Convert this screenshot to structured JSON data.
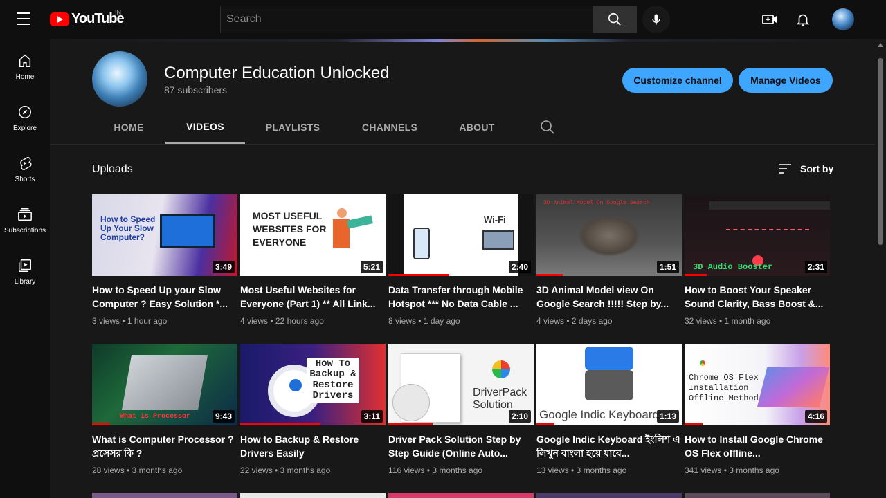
{
  "topbar": {
    "logo_text": "YouTube",
    "country_code": "IN",
    "search_placeholder": "Search"
  },
  "sidenav": [
    {
      "label": "Home",
      "icon": "home-icon"
    },
    {
      "label": "Explore",
      "icon": "compass-icon"
    },
    {
      "label": "Shorts",
      "icon": "shorts-icon"
    },
    {
      "label": "Subscriptions",
      "icon": "subscriptions-icon"
    },
    {
      "label": "Library",
      "icon": "library-icon"
    }
  ],
  "channel": {
    "name": "Computer Education Unlocked",
    "subscribers": "87 subscribers",
    "customize_label": "Customize channel",
    "manage_label": "Manage Videos"
  },
  "tabs": [
    "HOME",
    "VIDEOS",
    "PLAYLISTS",
    "CHANNELS",
    "ABOUT"
  ],
  "active_tab": "VIDEOS",
  "section": {
    "title": "Uploads",
    "sort_label": "Sort by"
  },
  "colors": {
    "accent": "#3ea6ff",
    "progress": "#ff0000",
    "background": "#181818"
  },
  "videos": [
    {
      "title": "How to Speed Up your Slow Computer ? Easy Solution *...",
      "meta": "3 views • 1 hour ago",
      "duration": "3:49",
      "thumb_text": "How to Speed Up Your Slow Computer?",
      "progress": 0
    },
    {
      "title": "Most Useful Websites for Everyone (Part 1) ** All Link...",
      "meta": "4 views • 22 hours ago",
      "duration": "5:21",
      "thumb_text": "MOST USEFUL WEBSITES FOR EVERYONE",
      "progress": 0
    },
    {
      "title": "Data Transfer through Mobile Hotspot *** No Data Cable ...",
      "meta": "8 views • 1 day ago",
      "duration": "2:40",
      "thumb_text": "Wi-Fi",
      "progress": 0.42
    },
    {
      "title": "3D Animal Model view On Google Search !!!!! Step by...",
      "meta": "4 views • 2 days ago",
      "duration": "1:51",
      "thumb_text": "3D Animal Model On Google Search",
      "progress": 0.18
    },
    {
      "title": "How to Boost Your Speaker Sound Clarity, Bass Boost &...",
      "meta": "32 views • 1 month ago",
      "duration": "2:31",
      "thumb_text": "3D Audio Booster",
      "progress": 0.15
    },
    {
      "title": "What is Computer Processor ? প্রসেসর কি ?",
      "meta": "28 views • 3 months ago",
      "duration": "9:43",
      "thumb_text": "What is Processor",
      "progress": 0.12
    },
    {
      "title": "How to Backup & Restore Drivers Easily",
      "meta": "22 views • 3 months ago",
      "duration": "3:11",
      "thumb_text": "How To Backup & Restore Drivers",
      "progress": 0.55
    },
    {
      "title": "Driver Pack Solution Step by Step Guide (Online Auto...",
      "meta": "116 views • 3 months ago",
      "duration": "2:10",
      "thumb_text": "DriverPack Solution",
      "progress": 0.3
    },
    {
      "title": "Google Indic Keyboard ইংলিশ এ লিখুন বাংলা হয়ে যাবে...",
      "meta": "13 views • 3 months ago",
      "duration": "1:13",
      "thumb_text": "Google Indic Keyboard",
      "progress": 0.12
    },
    {
      "title": "How to Install Google Chrome OS Flex offline...",
      "meta": "341 views • 3 months ago",
      "duration": "4:16",
      "thumb_text": "Chrome OS Flex Installation Offline Method",
      "progress": 0.12
    }
  ]
}
